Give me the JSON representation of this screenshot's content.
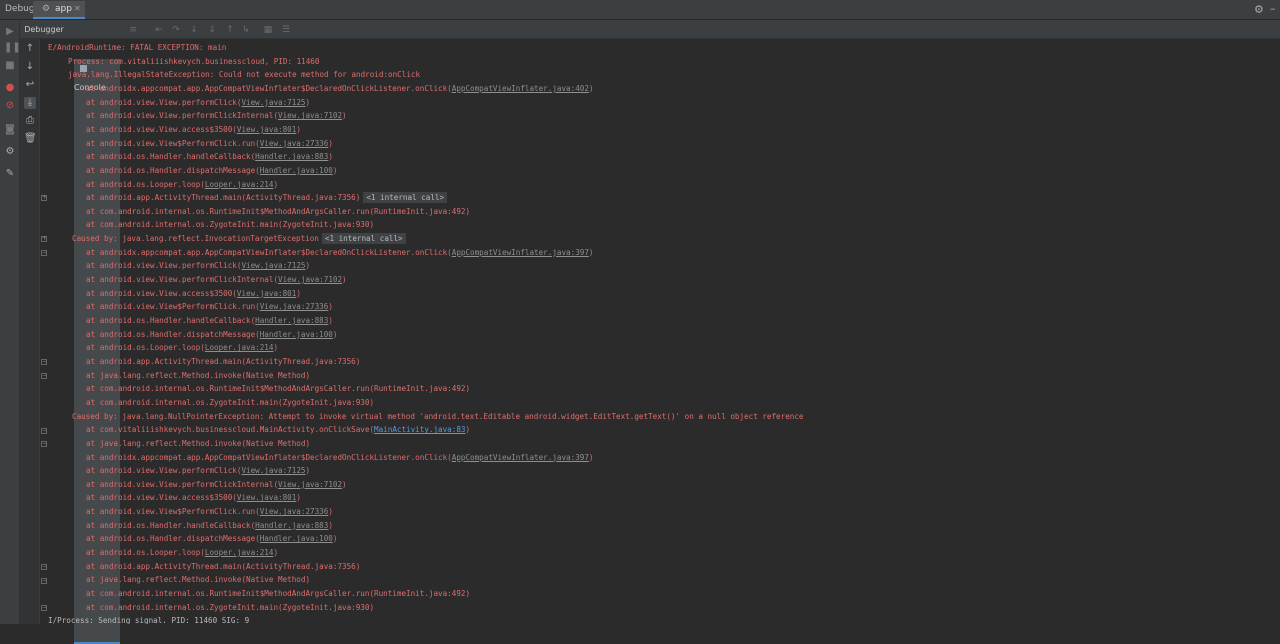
{
  "window": {
    "debug_label": "Debug:",
    "app_tab": "app",
    "app_tab_icon": "android-icon"
  },
  "tabs": {
    "debugger": "Debugger",
    "console": "Console"
  },
  "console_lines": [
    {
      "indent": 0,
      "pre": "E/AndroidRuntime: FATAL EXCEPTION: main",
      "link": "",
      "post": "",
      "tag": ""
    },
    {
      "indent": 20,
      "pre": "Process: com.vitaliiishkevych.businesscloud, PID: 11460",
      "link": "",
      "post": "",
      "tag": ""
    },
    {
      "indent": 20,
      "pre": "java.lang.IllegalStateException: Could not execute method for android:onClick",
      "link": "",
      "post": "",
      "tag": ""
    },
    {
      "indent": 38,
      "pre": "at androidx.appcompat.app.AppCompatViewInflater$DeclaredOnClickListener.onClick(",
      "link": "AppCompatViewInflater.java:402",
      "post": ")",
      "tag": ""
    },
    {
      "indent": 38,
      "pre": "at android.view.View.performClick(",
      "link": "View.java:7125",
      "post": ")",
      "tag": ""
    },
    {
      "indent": 38,
      "pre": "at android.view.View.performClickInternal(",
      "link": "View.java:7102",
      "post": ")",
      "tag": ""
    },
    {
      "indent": 38,
      "pre": "at android.view.View.access$3500(",
      "link": "View.java:801",
      "post": ")",
      "tag": ""
    },
    {
      "indent": 38,
      "pre": "at android.view.View$PerformClick.run(",
      "link": "View.java:27336",
      "post": ")",
      "tag": ""
    },
    {
      "indent": 38,
      "pre": "at android.os.Handler.handleCallback(",
      "link": "Handler.java:883",
      "post": ")",
      "tag": ""
    },
    {
      "indent": 38,
      "pre": "at android.os.Handler.dispatchMessage(",
      "link": "Handler.java:100",
      "post": ")",
      "tag": ""
    },
    {
      "indent": 38,
      "pre": "at android.os.Looper.loop(",
      "link": "Looper.java:214",
      "post": ")",
      "tag": ""
    },
    {
      "indent": 38,
      "pre": "at android.app.ActivityThread.main(ActivityThread.java:7356)",
      "link": "",
      "post": "",
      "tag": "<1 internal call>"
    },
    {
      "indent": 38,
      "pre": "at com.android.internal.os.RuntimeInit$MethodAndArgsCaller.run(RuntimeInit.java:492)",
      "link": "",
      "post": "",
      "tag": ""
    },
    {
      "indent": 38,
      "pre": "at com.android.internal.os.ZygoteInit.main(ZygoteInit.java:930)",
      "link": "",
      "post": "",
      "tag": ""
    },
    {
      "indent": 24,
      "pre": "Caused by: java.lang.reflect.InvocationTargetException",
      "link": "",
      "post": "",
      "tag": "<1 internal call>"
    },
    {
      "indent": 38,
      "pre": "at androidx.appcompat.app.AppCompatViewInflater$DeclaredOnClickListener.onClick(",
      "link": "AppCompatViewInflater.java:397",
      "post": ")",
      "tag": ""
    },
    {
      "indent": 38,
      "pre": "at android.view.View.performClick(",
      "link": "View.java:7125",
      "post": ")",
      "tag": ""
    },
    {
      "indent": 38,
      "pre": "at android.view.View.performClickInternal(",
      "link": "View.java:7102",
      "post": ")",
      "tag": ""
    },
    {
      "indent": 38,
      "pre": "at android.view.View.access$3500(",
      "link": "View.java:801",
      "post": ")",
      "tag": ""
    },
    {
      "indent": 38,
      "pre": "at android.view.View$PerformClick.run(",
      "link": "View.java:27336",
      "post": ")",
      "tag": ""
    },
    {
      "indent": 38,
      "pre": "at android.os.Handler.handleCallback(",
      "link": "Handler.java:883",
      "post": ")",
      "tag": ""
    },
    {
      "indent": 38,
      "pre": "at android.os.Handler.dispatchMessage(",
      "link": "Handler.java:100",
      "post": ")",
      "tag": ""
    },
    {
      "indent": 38,
      "pre": "at android.os.Looper.loop(",
      "link": "Looper.java:214",
      "post": ")",
      "tag": ""
    },
    {
      "indent": 38,
      "pre": "at android.app.ActivityThread.main(ActivityThread.java:7356)",
      "link": "",
      "post": "",
      "tag": ""
    },
    {
      "indent": 38,
      "pre": "at java.lang.reflect.Method.invoke(Native Method)",
      "link": "",
      "post": "",
      "tag": ""
    },
    {
      "indent": 38,
      "pre": "at com.android.internal.os.RuntimeInit$MethodAndArgsCaller.run(RuntimeInit.java:492)",
      "link": "",
      "post": "",
      "tag": ""
    },
    {
      "indent": 38,
      "pre": "at com.android.internal.os.ZygoteInit.main(ZygoteInit.java:930)",
      "link": "",
      "post": "",
      "tag": ""
    },
    {
      "indent": 24,
      "pre": "Caused by: java.lang.NullPointerException: Attempt to invoke virtual method 'android.text.Editable android.widget.EditText.getText()' on a null object reference",
      "link": "",
      "post": "",
      "tag": ""
    },
    {
      "indent": 38,
      "pre": "at com.vitaliiishkevych.businesscloud.MainActivity.onClickSave(",
      "link": "MainActivity.java:83",
      "post": ")",
      "tag": "",
      "blue": true
    },
    {
      "indent": 38,
      "pre": "at java.lang.reflect.Method.invoke(Native Method)",
      "link": "",
      "post": "",
      "tag": ""
    },
    {
      "indent": 38,
      "pre": "at androidx.appcompat.app.AppCompatViewInflater$DeclaredOnClickListener.onClick(",
      "link": "AppCompatViewInflater.java:397",
      "post": ")",
      "tag": ""
    },
    {
      "indent": 38,
      "pre": "at android.view.View.performClick(",
      "link": "View.java:7125",
      "post": ")",
      "tag": ""
    },
    {
      "indent": 38,
      "pre": "at android.view.View.performClickInternal(",
      "link": "View.java:7102",
      "post": ")",
      "tag": ""
    },
    {
      "indent": 38,
      "pre": "at android.view.View.access$3500(",
      "link": "View.java:801",
      "post": ")",
      "tag": ""
    },
    {
      "indent": 38,
      "pre": "at android.view.View$PerformClick.run(",
      "link": "View.java:27336",
      "post": ")",
      "tag": ""
    },
    {
      "indent": 38,
      "pre": "at android.os.Handler.handleCallback(",
      "link": "Handler.java:883",
      "post": ")",
      "tag": ""
    },
    {
      "indent": 38,
      "pre": "at android.os.Handler.dispatchMessage(",
      "link": "Handler.java:100",
      "post": ")",
      "tag": ""
    },
    {
      "indent": 38,
      "pre": "at android.os.Looper.loop(",
      "link": "Looper.java:214",
      "post": ")",
      "tag": ""
    },
    {
      "indent": 38,
      "pre": "at android.app.ActivityThread.main(ActivityThread.java:7356)",
      "link": "",
      "post": "",
      "tag": ""
    },
    {
      "indent": 38,
      "pre": "at java.lang.reflect.Method.invoke(Native Method)",
      "link": "",
      "post": "",
      "tag": ""
    },
    {
      "indent": 38,
      "pre": "at com.android.internal.os.RuntimeInit$MethodAndArgsCaller.run(RuntimeInit.java:492)",
      "link": "",
      "post": "",
      "tag": ""
    },
    {
      "indent": 38,
      "pre": "at com.android.internal.os.ZygoteInit.main(ZygoteInit.java:930)",
      "link": "",
      "post": "",
      "tag": ""
    },
    {
      "indent": 0,
      "pre": "I/Process: Sending signal. PID: 11460 SIG: 9",
      "link": "",
      "post": "",
      "tag": "",
      "info": true
    }
  ],
  "colors": {
    "error_text": "#e06c6c",
    "link_text": "#8f8f8f",
    "source_link": "#5a9ae0",
    "background": "#2b2b2b",
    "accent": "#4a88c7"
  }
}
